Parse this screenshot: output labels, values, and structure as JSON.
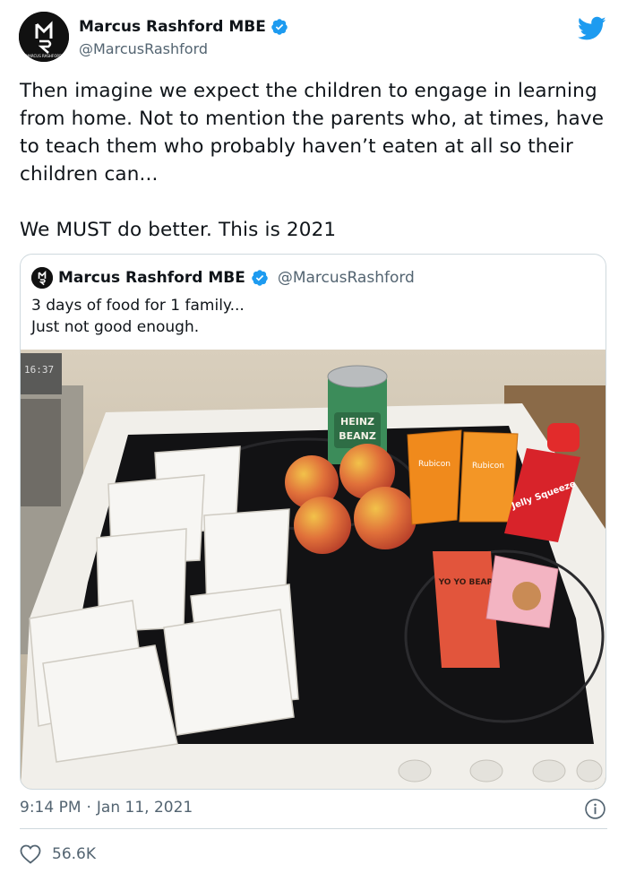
{
  "author": {
    "name": "Marcus Rashford MBE",
    "handle": "@MarcusRashford",
    "avatar_label": "MARCUS RASHFORD",
    "avatar_letters": "M R",
    "verified": true
  },
  "tweet": {
    "text": "Then imagine we expect the children to engage in learning from home. Not to mention the parents who, at times, have to teach them who probably haven’t eaten at all so their children can...\n\nWe MUST do better. This is 2021"
  },
  "quoted_tweet": {
    "name": "Marcus Rashford MBE",
    "handle": "@MarcusRashford",
    "text": "3 days of food for 1 family...\nJust not good enough.",
    "photo_labels": {
      "can_brand": "HEINZ",
      "can_product": "BEANZ",
      "juice_label": "Rubicon",
      "jelly_label": "Jelly Squeeze",
      "bar_label": "YO YO BEAR",
      "clock": "16:37"
    }
  },
  "meta": {
    "time": "9:14 PM",
    "separator": "·",
    "date": "Jan 11, 2021",
    "likes": "56.6K"
  },
  "colors": {
    "twitter_blue": "#1d9bf0",
    "secondary_text": "#536471",
    "border": "#cfd9de"
  },
  "icons": [
    "twitter-bird-icon",
    "verified-badge-icon",
    "info-icon",
    "heart-icon"
  ]
}
